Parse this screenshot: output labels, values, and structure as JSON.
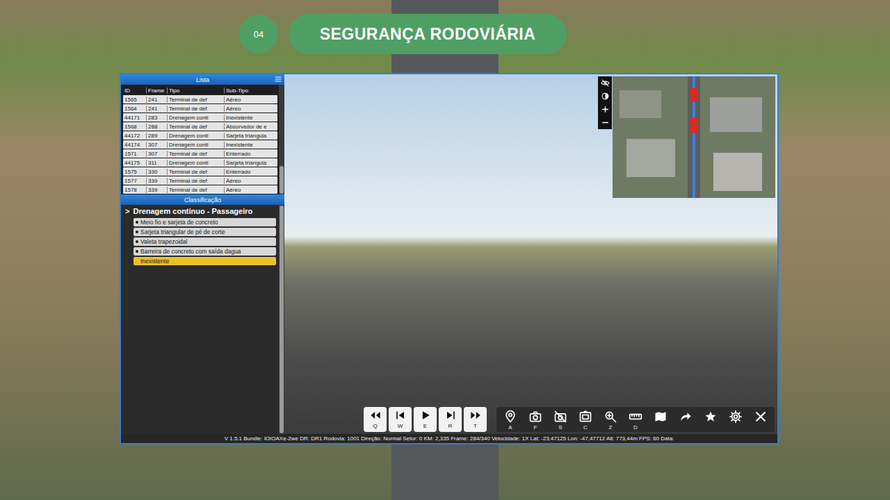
{
  "slide": {
    "badge": "04",
    "title": "SEGURANÇA RODOVIÁRIA"
  },
  "list": {
    "title": "Lista",
    "columns": [
      "ID",
      "Frame",
      "Tipo",
      "Sub-Tipo"
    ],
    "rows": [
      {
        "id": "1565",
        "frame": "241",
        "type": "Terminal de def",
        "subtype": "Aéreo",
        "selected": false
      },
      {
        "id": "1564",
        "frame": "241",
        "type": "Terminal de def",
        "subtype": "Aéreo",
        "selected": false
      },
      {
        "id": "44171",
        "frame": "283",
        "type": "Drenagem conti",
        "subtype": "Inexistente",
        "selected": false
      },
      {
        "id": "1568",
        "frame": "288",
        "type": "Terminal de def",
        "subtype": "Absorvedor de e",
        "selected": false
      },
      {
        "id": "44172",
        "frame": "289",
        "type": "Drenagem conti",
        "subtype": "Sarjeta triangula",
        "selected": false
      },
      {
        "id": "44174",
        "frame": "307",
        "type": "Drenagem conti",
        "subtype": "Inexistente",
        "selected": false
      },
      {
        "id": "1571",
        "frame": "307",
        "type": "Terminal de def",
        "subtype": "Enterrado",
        "selected": false
      },
      {
        "id": "44175",
        "frame": "311",
        "type": "Drenagem conti",
        "subtype": "Sarjeta triangula",
        "selected": false
      },
      {
        "id": "1575",
        "frame": "330",
        "type": "Terminal de def",
        "subtype": "Enterrado",
        "selected": false
      },
      {
        "id": "1577",
        "frame": "339",
        "type": "Terminal de def",
        "subtype": "Aéreo",
        "selected": false
      },
      {
        "id": "1578",
        "frame": "339",
        "type": "Terminal de def",
        "subtype": "Aéreo",
        "selected": false
      }
    ]
  },
  "classification": {
    "title": "Classificação",
    "expander": ">",
    "group": "Drenagem continuo - Passageiro",
    "options": [
      {
        "label": "Meio fio e sarjeta de concreto",
        "selected": false
      },
      {
        "label": "Sarjeta triangular de pé de corte",
        "selected": false
      },
      {
        "label": "Valeta trapezoidal",
        "selected": false
      },
      {
        "label": "Barreira de concreto com saída dagua",
        "selected": false
      },
      {
        "label": "Inexistente",
        "selected": true
      }
    ]
  },
  "map_controls": [
    {
      "kind": "eye-off"
    },
    {
      "kind": "contrast"
    },
    {
      "kind": "plus"
    },
    {
      "kind": "minus"
    }
  ],
  "player": [
    {
      "kind": "rewind",
      "key": "Q"
    },
    {
      "kind": "step-back",
      "key": "W"
    },
    {
      "kind": "play",
      "key": "E"
    },
    {
      "kind": "step-forward",
      "key": "R"
    },
    {
      "kind": "fast-forward",
      "key": "T"
    }
  ],
  "tools": [
    {
      "kind": "pin",
      "key": "A"
    },
    {
      "kind": "camera",
      "key": "F"
    },
    {
      "kind": "camera-off",
      "key": "S"
    },
    {
      "kind": "camera-frame",
      "key": "C"
    },
    {
      "kind": "zoom",
      "key": "Z"
    },
    {
      "kind": "ruler",
      "key": "D"
    },
    {
      "kind": "map"
    },
    {
      "kind": "share"
    },
    {
      "kind": "star"
    },
    {
      "kind": "gear"
    },
    {
      "kind": "close"
    }
  ],
  "status_bar": "V 1.5.1 Bundle: IOIOAXe-2we DR: DR1 Rodovia: 1001 Direção: Normal Setor: 0 KM: 2,335 Frame: 284/340 Velocidade: 1X Lat: -23,47125 Lon: -47,47712 Alt: 773,44m FPS: 60 Data:"
}
